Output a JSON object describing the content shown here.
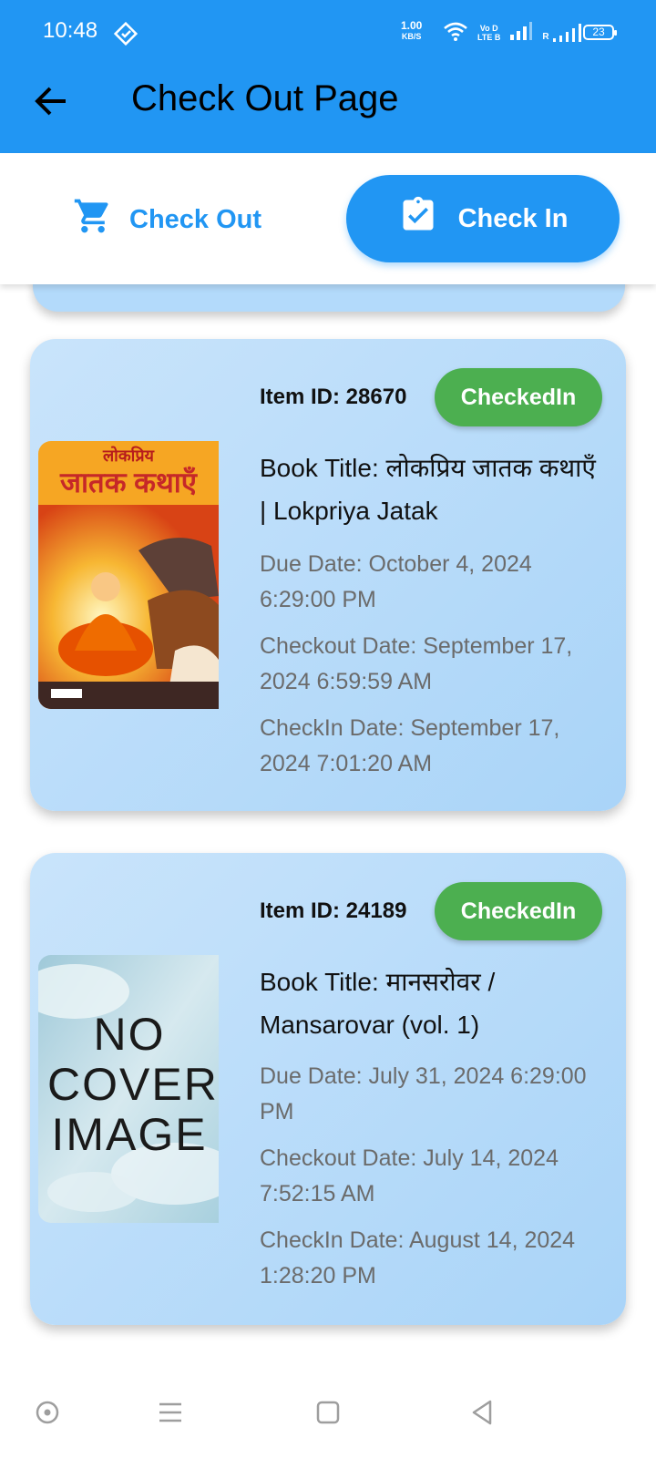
{
  "status_bar": {
    "time": "10:48",
    "net_speed_value": "1.00",
    "net_speed_unit": "KB/S",
    "volte_top": "Vo D",
    "volte_bottom": "LTE B",
    "roaming_label": "R",
    "battery_level": "23",
    "icons": [
      "vpn-icon",
      "wifi-icon",
      "volte-icon",
      "signal-icon",
      "signal-roaming-icon",
      "battery-icon"
    ]
  },
  "app_bar": {
    "title": "Check Out Page",
    "color": "#2196F3"
  },
  "toggle": {
    "checkout_label": "Check Out",
    "checkin_label": "Check In",
    "active": "Check In"
  },
  "cards": [
    {
      "item_id": "Item ID: 28670",
      "status": "CheckedIn",
      "title": "Book Title:  लोकप्रिय जातक कथाएँ  |  Lokpriya Jatak",
      "cover_top_text": "लोकप्रिय",
      "cover_main_text": "जातक कथाएँ",
      "due_date": "Due Date: October 4, 2024 6:29:00 PM",
      "checkout_date": "Checkout Date: September 17, 2024 6:59:59 AM",
      "checkin_date": "CheckIn Date: September 17, 2024 7:01:20 AM"
    },
    {
      "item_id": "Item ID: 24189",
      "status": "CheckedIn",
      "title": "Book Title: मानसरोवर / Mansarovar (vol. 1)",
      "cover_text": "NO COVER IMAGE",
      "due_date": "Due Date: July 31, 2024 6:29:00 PM",
      "checkout_date": "Checkout Date: July 14, 2024 7:52:15 AM",
      "checkin_date": "CheckIn Date: August 14, 2024 1:28:20 PM"
    }
  ],
  "nav_bar": {
    "icons": [
      "home-circle-icon",
      "menu-icon",
      "square-icon",
      "back-triangle-icon"
    ]
  }
}
